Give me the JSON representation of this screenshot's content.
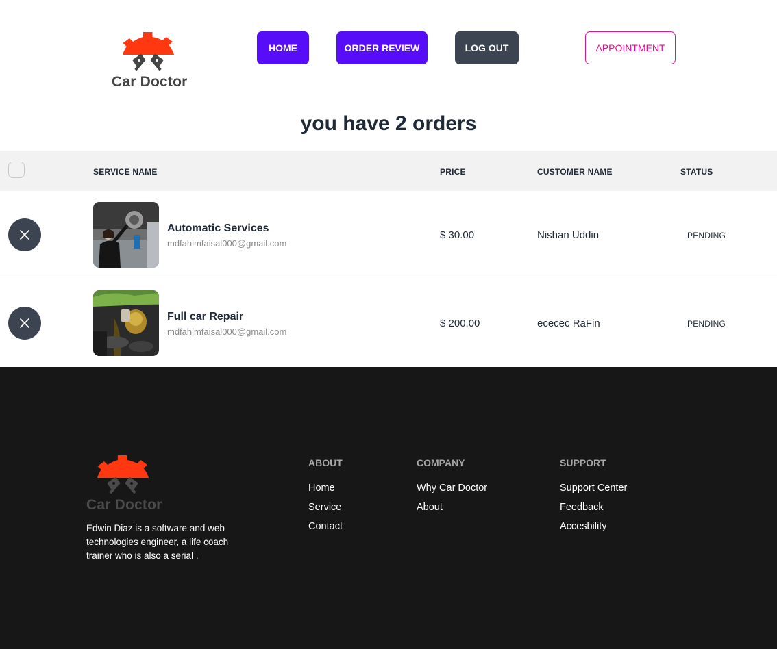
{
  "header": {
    "logo_text": "Car Doctor",
    "nav": {
      "home": "HOME",
      "order_review": "ORDER REVIEW",
      "logout": "LOG OUT",
      "appointment": "APPOINTMENT"
    }
  },
  "page": {
    "title": "you have 2 orders"
  },
  "table": {
    "headers": {
      "service": "SERVICE NAME",
      "price": "PRICE",
      "customer": "CUSTOMER NAME",
      "status": "STATUS"
    },
    "rows": [
      {
        "service": "Automatic Services",
        "email": "mdfahimfaisal000@gmail.com",
        "price": "$ 30.00",
        "customer": "Nishan Uddin",
        "status": "PENDING"
      },
      {
        "service": "Full car Repair",
        "email": "mdfahimfaisal000@gmail.com",
        "price": "$ 200.00",
        "customer": "ececec RaFin",
        "status": "PENDING"
      }
    ]
  },
  "footer": {
    "logo_text": "Car Doctor",
    "description": "Edwin Diaz is a software and web technologies engineer, a life coach trainer who is also a serial .",
    "columns": [
      {
        "title": "ABOUT",
        "links": [
          "Home",
          "Service",
          "Contact"
        ]
      },
      {
        "title": "COMPANY",
        "links": [
          "Why Car Doctor",
          "About"
        ]
      },
      {
        "title": "SUPPORT",
        "links": [
          "Support Center",
          "Feedback",
          "Accesbility"
        ]
      }
    ]
  },
  "colors": {
    "primary": "#570df8",
    "neutral": "#3d4451",
    "accent": "#e0138f",
    "logo_orange": "#ff3811",
    "footer_bg": "#171717"
  },
  "icons": {
    "logo": "gear-piston-logo-icon",
    "delete": "close-icon"
  }
}
